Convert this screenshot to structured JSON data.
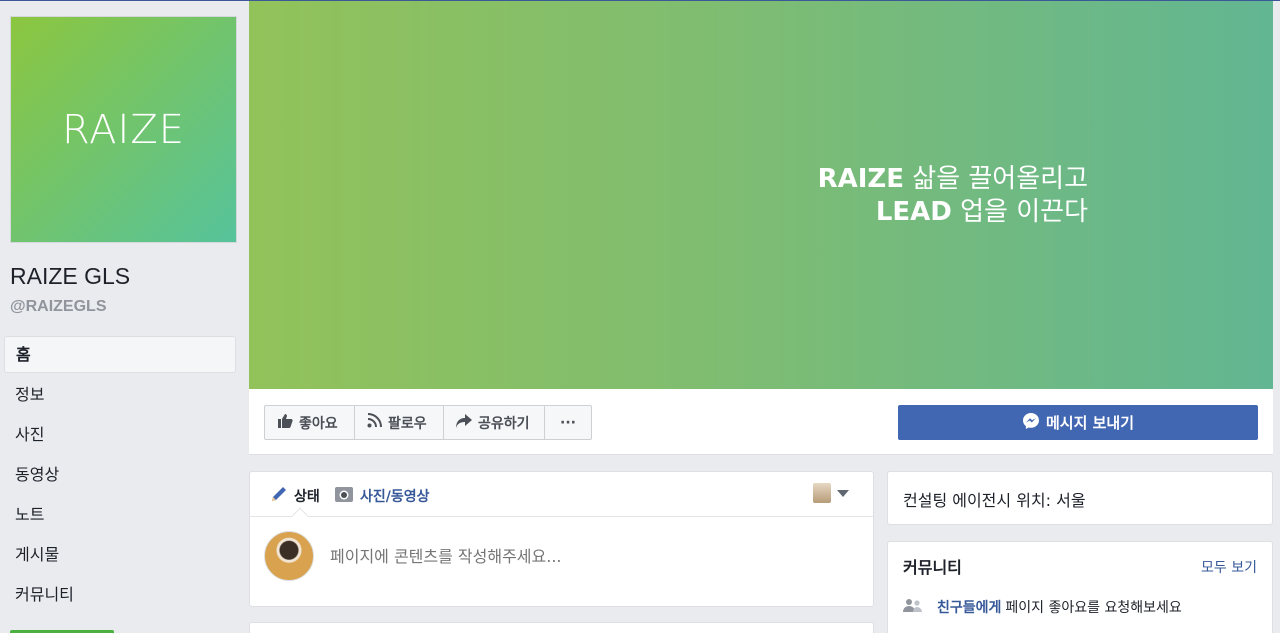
{
  "brand": {
    "logo_text": "RAIZE",
    "page_name": "RAIZE GLS",
    "handle": "@RAIZEGLS",
    "gradient_start": "#8cc63f",
    "gradient_end": "#56c39b"
  },
  "sidebar": {
    "items": [
      {
        "label": "홈",
        "active": true
      },
      {
        "label": "정보"
      },
      {
        "label": "사진"
      },
      {
        "label": "동영상"
      },
      {
        "label": "노트"
      },
      {
        "label": "게시물"
      },
      {
        "label": "커뮤니티"
      }
    ]
  },
  "cover": {
    "line1_bold": "RAIZE",
    "line1_rest": " 삶을 끌어올리고",
    "line2_bold": "LEAD",
    "line2_rest": " 업을 이끈다"
  },
  "actions": {
    "like": "좋아요",
    "follow": "팔로우",
    "share": "공유하기",
    "more": "···",
    "message": "메시지 보내기",
    "message_color": "#4267b2"
  },
  "composer": {
    "tab_status": "상태",
    "tab_photo": "사진/동영상",
    "placeholder": "페이지에 콘텐츠를 작성해주세요..."
  },
  "info": {
    "text": "컨설팅 에이전시 위치: 서울"
  },
  "community": {
    "title": "커뮤니티",
    "see_all": "모두 보기",
    "invite_link": "친구들에게",
    "invite_rest": "페이지 좋아요를 요청해보세요"
  }
}
